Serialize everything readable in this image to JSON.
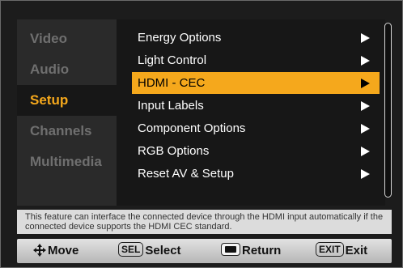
{
  "sidebar": {
    "items": [
      {
        "label": "Video"
      },
      {
        "label": "Audio"
      },
      {
        "label": "Setup"
      },
      {
        "label": "Channels"
      },
      {
        "label": "Multimedia"
      }
    ],
    "active": "Setup"
  },
  "menu": {
    "items": [
      {
        "label": "Energy Options"
      },
      {
        "label": "Light Control"
      },
      {
        "label": "HDMI - CEC"
      },
      {
        "label": "Input Labels"
      },
      {
        "label": "Component Options"
      },
      {
        "label": "RGB Options"
      },
      {
        "label": "Reset AV & Setup"
      }
    ],
    "selected": "HDMI - CEC"
  },
  "help": {
    "text": "This feature can interface the connected device through the HDMI input automatically if the connected device supports the HDMI CEC standard."
  },
  "bottom_bar": {
    "move_label": "Move",
    "sel_key": "SEL",
    "select_label": "Select",
    "return_label": "Return",
    "exit_key": "EXIT",
    "exit_label": "Exit"
  },
  "colors": {
    "accent": "#f5a81c",
    "panel": "#171717",
    "sidebar": "#2a2a2a"
  },
  "icons": [
    "move-arrows-icon",
    "return-key-icon",
    "chevron-right-icon"
  ]
}
